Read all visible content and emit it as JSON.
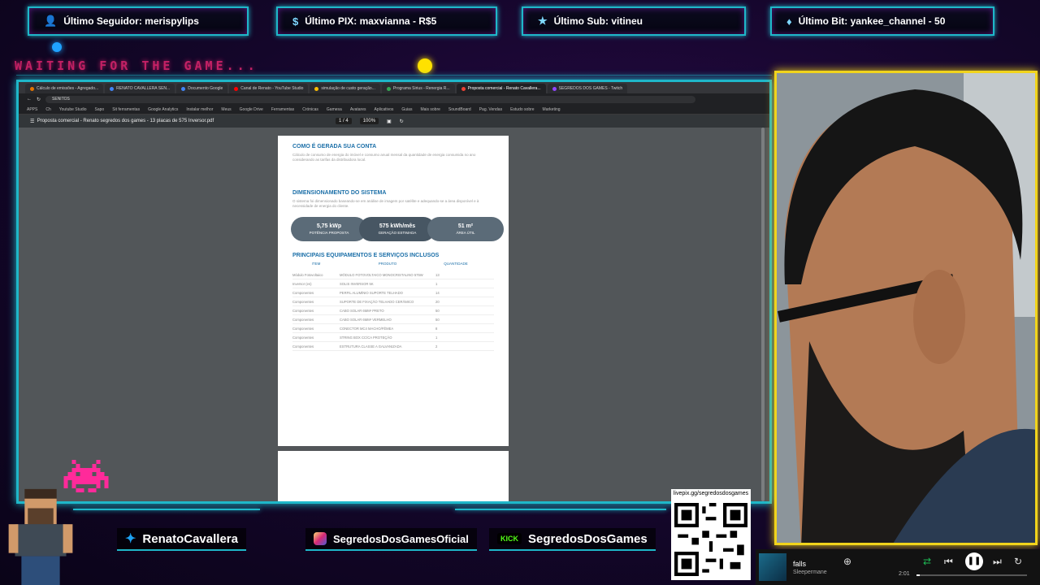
{
  "alerts": [
    {
      "label": "Último Seguidor: merispylips",
      "icon": "person-icon"
    },
    {
      "label": "Último PIX: maxvianna - R$5",
      "icon": "dollar-icon"
    },
    {
      "label": "Último Sub: vitineu",
      "icon": "star-icon"
    },
    {
      "label": "Último Bit: yankee_channel - 50",
      "icon": "diamond-icon"
    }
  ],
  "overlay_title": "WAITING FOR THE GAME...",
  "browser": {
    "tabs": [
      "Cálculo de emissões - Agregado...",
      "RENATO CAVALLERA SEN...",
      "Documento Google",
      "Canal de Renato - YouTube Studio",
      "simulação de custo geração...",
      "Programa Sirius - Renergia R...",
      "Proposta comercial - Renato Cavallera...",
      "SEGREDOS DOS GAMES - Twitch"
    ],
    "address": "SENITOS",
    "bookmarks": [
      "APPS",
      "Ch",
      "Youtube Studio",
      "Sapo",
      "Sit ferramentas",
      "Google Analytics",
      "Instalar melhor",
      "Meus",
      "Google Drive",
      "Ferramentas",
      "Crónicas",
      "Gamesa",
      "Avatares",
      "Aplicativos",
      "Guias",
      "Mais sobre",
      "SoundBoard",
      "Pag. Vendas",
      "Estudo sobre",
      "Marketing"
    ],
    "pdf_title": "Proposta comercial - Renato segredos dos games - 13 placas de 575 Inversor.pdf",
    "page_num": "1 / 4",
    "zoom": "100%"
  },
  "pdf": {
    "section1_title": "COMO É GERADA SUA CONTA",
    "section1_text": "Cálculo de consumo de energia do imóvel e consumo anual mensal da quantidade de energia consumida no ano considerando as tarifas da distribuidora local.",
    "section2_title": "DIMENSIONAMENTO DO SISTEMA",
    "section2_text": "O sistema foi dimensionado baseando-se em análise de imagem por satélite e adequando-se a área disponível e à necessidade de energia do cliente.",
    "pills": [
      {
        "value": "5,75 kWp",
        "label": "POTÊNCIA PROPOSTA"
      },
      {
        "value": "575 kWh/mês",
        "label": "GERAÇÃO ESTIMADA"
      },
      {
        "value": "51 m²",
        "label": "ÁREA ÚTIL"
      }
    ],
    "equipment_title": "PRINCIPAIS EQUIPAMENTOS E SERVIÇOS INCLUSOS",
    "equipment_headers": [
      "ITEM",
      "PRODUTO",
      "QUANTIDADE"
    ],
    "equipment_rows": [
      {
        "item": "Módulo Fotovoltaico",
        "product": "MÓDULO FOTOVOLTAICO MONOCRISTALINO 575W",
        "qty": "13"
      },
      {
        "item": "Inversor (es)",
        "product": "SOLIS INVERSOR 5K",
        "qty": "1"
      },
      {
        "item": "Componentes",
        "product": "PERFIL ALUMÍNIO SUPORTE TELHADO",
        "qty": "14"
      },
      {
        "item": "Componentes",
        "product": "SUPORTE DE FIXAÇÃO TELHADO CERÂMICO",
        "qty": "20"
      },
      {
        "item": "Componentes",
        "product": "CABO SOLAR 6MM² PRETO",
        "qty": "50"
      },
      {
        "item": "Componentes",
        "product": "CABO SOLAR 6MM² VERMELHO",
        "qty": "50"
      },
      {
        "item": "Componentes",
        "product": "CONECTOR MC4 MACHO/FÊMEA",
        "qty": "8"
      },
      {
        "item": "Componentes",
        "product": "STRING BOX CC/CA PROTEÇÃO",
        "qty": "1"
      },
      {
        "item": "Componentes",
        "product": "ESTRUTURA CLASSE A GALVANIZADA",
        "qty": "2"
      }
    ]
  },
  "socials": [
    {
      "label": "RenatoCavallera",
      "icon": "twitter-icon",
      "color": "#1DA1F2"
    },
    {
      "label": "SegredosDosGamesOficial",
      "icon": "instagram-icon",
      "color": "#E1306C"
    },
    {
      "label": "SegredosDosGames",
      "icon": "kick-icon",
      "badge": "KICK",
      "color": "#53FC18"
    }
  ],
  "qr_label": "livepix.gg/segredosdosgames",
  "player": {
    "title": "falls",
    "artist": "Sleepermane",
    "elapsed": "2:01",
    "progress": 0.03
  },
  "colors": {
    "neon_cyan": "#1fb7c9",
    "neon_pink": "#ff2a7a",
    "cam_border": "#f1d41c"
  }
}
